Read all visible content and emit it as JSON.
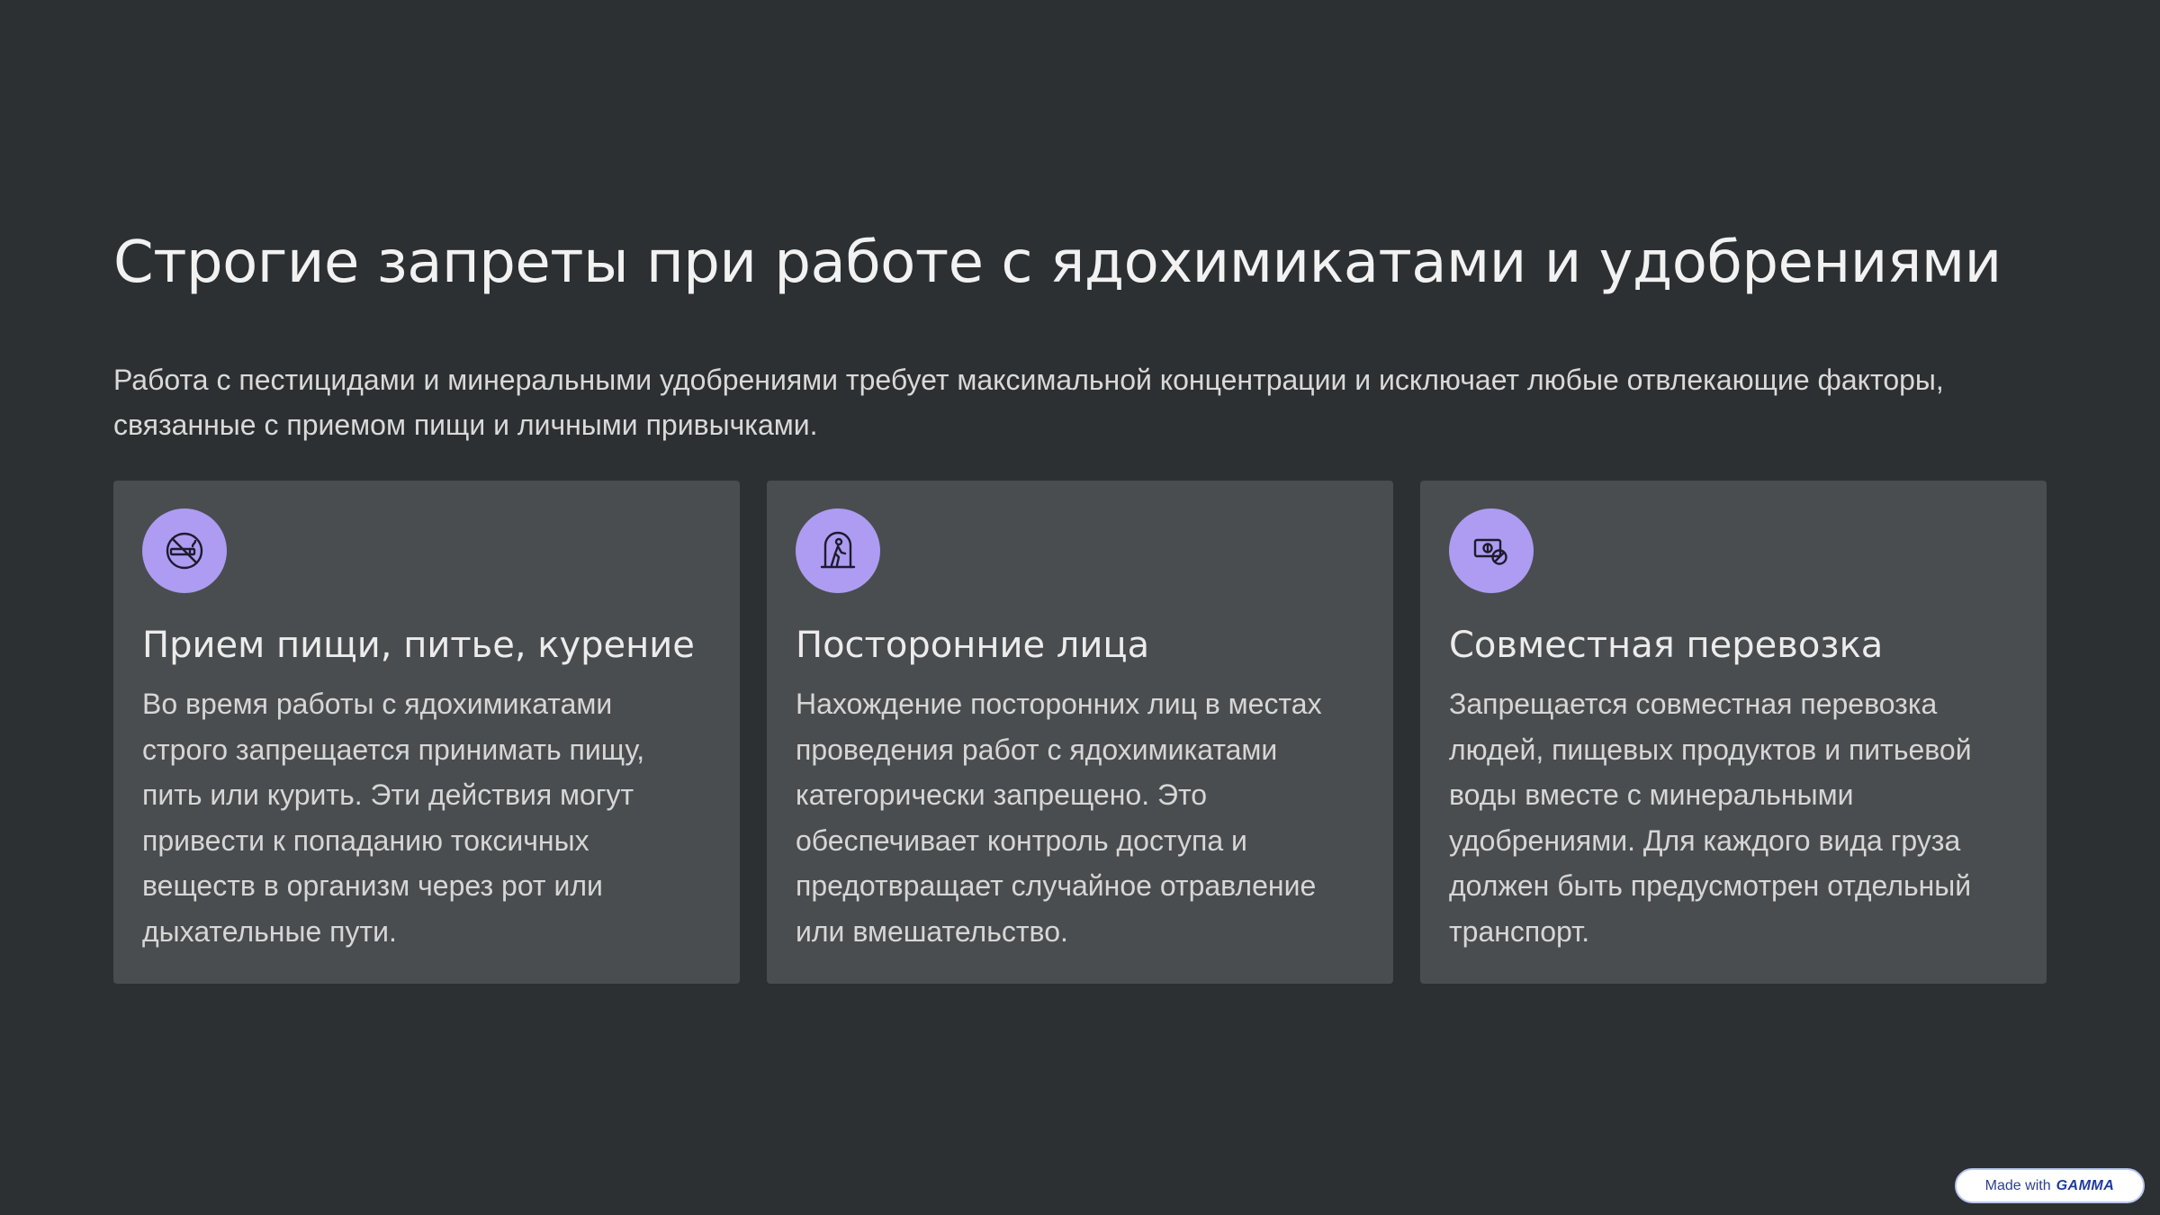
{
  "slide": {
    "title": "Строгие запреты при работе с ядохимикатами и удобрениями",
    "subtitle": "Работа с пестицидами и минеральными удобрениями требует максимальной концентрации и исключает любые отвлекающие факторы, связанные с приемом пищи и личными привычками."
  },
  "cards": [
    {
      "icon": "no-smoking-icon",
      "title": "Прием пищи, питье, курение",
      "text": "Во время работы с ядохимикатами строго запрещается принимать пищу, пить или курить. Эти действия могут привести к попаданию токсичных веществ в организм через рот или дыхательные пути."
    },
    {
      "icon": "person-in-doorway-icon",
      "title": "Посторонние лица",
      "text": "Нахождение посторонних лиц в местах проведения работ с ядохимикатами категорически запрещено. Это обеспечивает контроль доступа и предотвращает случайное отравление или вмешательство."
    },
    {
      "icon": "no-money-transport-icon",
      "title": "Совместная перевозка",
      "text": "Запрещается совместная перевозка людей, пищевых продуктов и питьевой воды вместе с минеральными удобрениями. Для каждого вида груза должен быть предусмотрен отдельный транспорт."
    }
  ],
  "badge": {
    "prefix": "Made with",
    "brand": "GAMMA"
  },
  "colors": {
    "background": "#2d3032",
    "card": "#4a4d4f",
    "icon_badge": "#ad9cf2"
  }
}
